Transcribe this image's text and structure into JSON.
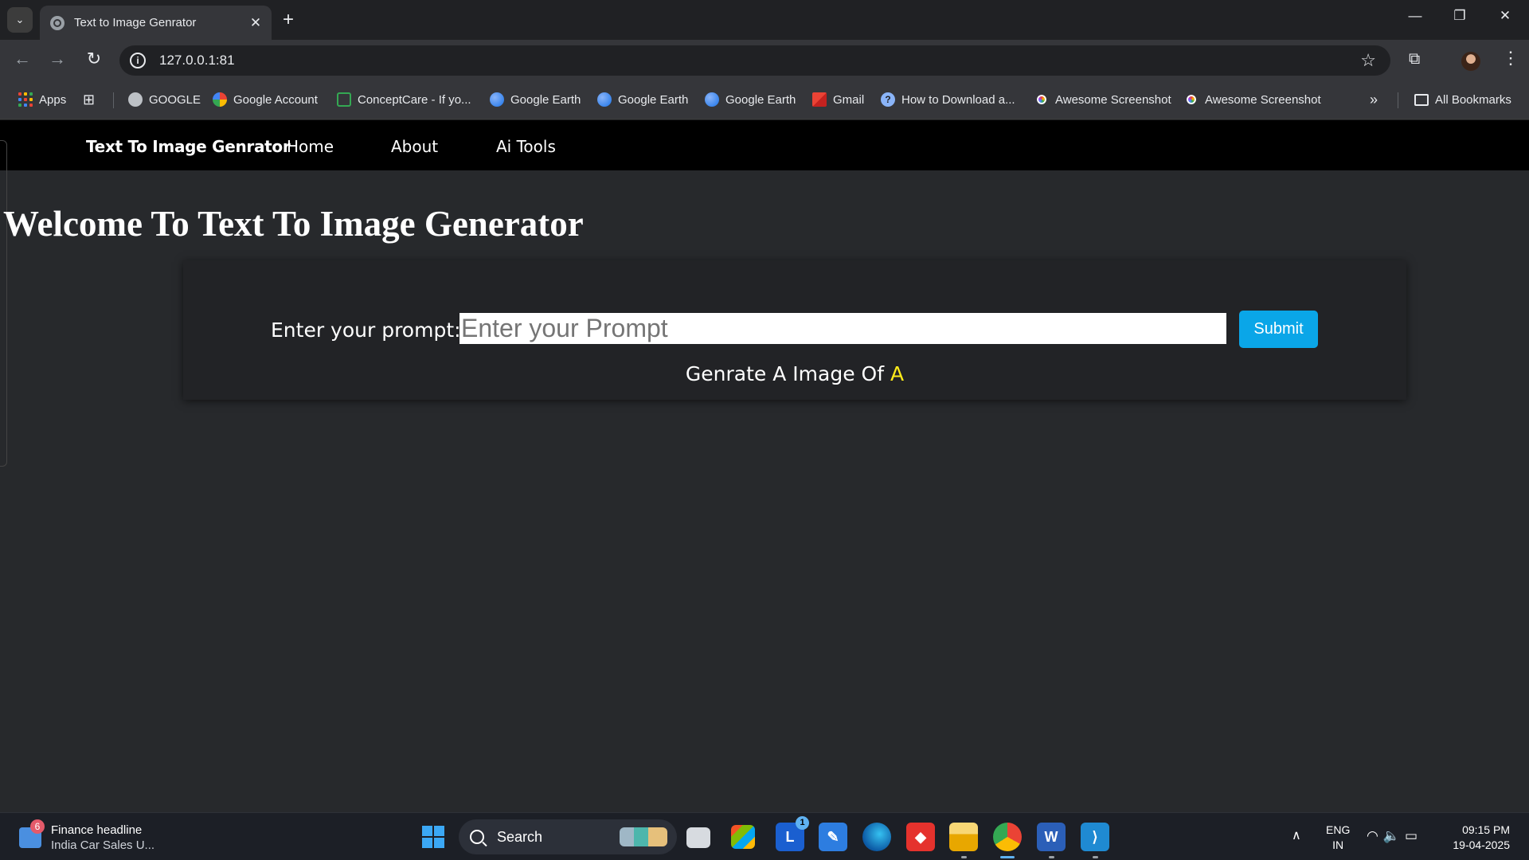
{
  "browser": {
    "tab_title": "Text to Image Genrator",
    "url": "127.0.0.1:81",
    "bookmarks": [
      {
        "label": "Apps",
        "icon": "apps-icon"
      },
      {
        "label": "GOOGLE",
        "icon": "globe-icon"
      },
      {
        "label": "Google Account",
        "icon": "google-icon"
      },
      {
        "label": "ConceptCare - If yo...",
        "icon": "conceptcare-icon"
      },
      {
        "label": "Google Earth",
        "icon": "earth-icon"
      },
      {
        "label": "Google Earth",
        "icon": "earth-icon"
      },
      {
        "label": "Google Earth",
        "icon": "earth-icon"
      },
      {
        "label": "Gmail",
        "icon": "gmail-icon"
      },
      {
        "label": "How to Download a...",
        "icon": "help-icon"
      },
      {
        "label": "Awesome Screenshot",
        "icon": "screenshot-icon"
      },
      {
        "label": "Awesome Screenshot",
        "icon": "screenshot-icon"
      }
    ],
    "all_bookmarks": "All Bookmarks"
  },
  "site": {
    "brand": "Text To Image Genrator",
    "nav": [
      "Home",
      "About",
      "Ai Tools"
    ],
    "heading": "Welcome To Text To Image Generator",
    "prompt_label": "Enter your prompt:",
    "prompt_placeholder": "Enter your Prompt",
    "submit_label": "Submit",
    "result_prefix": "Genrate A Image Of",
    "result_value": "A"
  },
  "taskbar": {
    "news_badge": "6",
    "news_title": "Finance headline",
    "news_sub": "India Car Sales U...",
    "search_label": "Search",
    "lang_line1": "ENG",
    "lang_line2": "IN",
    "time": "09:15 PM",
    "date": "19-04-2025",
    "mail_badge": "1"
  },
  "colors": {
    "accent": "#0aa6e8",
    "highlight": "#ffeb1a",
    "navbar": "#000000",
    "page_bg": "#27292c"
  }
}
